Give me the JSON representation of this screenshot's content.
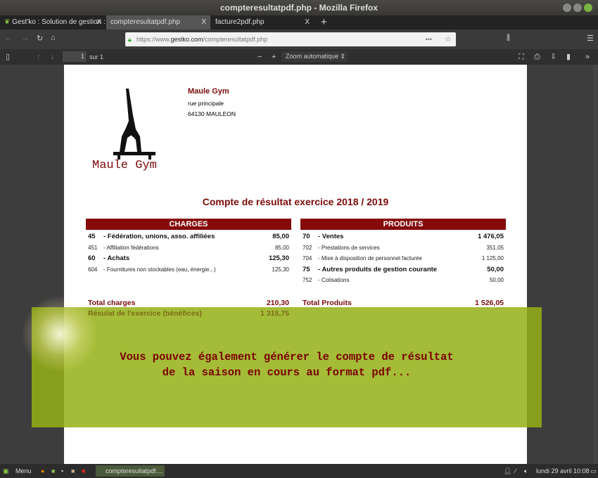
{
  "window": {
    "title": "compteresultatpdf.php - Mozilla Firefox"
  },
  "tabs": [
    {
      "label": "Gest'ko : Solution de gestion :",
      "close": "X"
    },
    {
      "label": "compteresultatpdf.php",
      "close": "X"
    },
    {
      "label": "facture2pdf.php",
      "close": "X"
    }
  ],
  "new_tab": "+",
  "url": {
    "prefix": "https://www.",
    "domain": "gestko.com",
    "path": "/compteresultatpdf.php",
    "more": "•••"
  },
  "pdf": {
    "page": "1",
    "of": "sur 1",
    "zoom": "Zoom automatique",
    "minus": "−",
    "plus": "+"
  },
  "company": {
    "name": "Maule Gym",
    "street": "rue principale",
    "city": "64130 MAULEON",
    "logo_text": "Maule Gym"
  },
  "report_title": "Compte de résultat exercice 2018 / 2019",
  "charges": {
    "header": "CHARGES",
    "rows": [
      {
        "code": "45",
        "label": "- Fédération, unions, asso. affiliées",
        "value": "85,00",
        "bold": true
      },
      {
        "code": "451",
        "label": "- Affiliation fédérations",
        "value": "85,00",
        "bold": false
      },
      {
        "code": "60",
        "label": "- Achats",
        "value": "125,30",
        "bold": true
      },
      {
        "code": "604",
        "label": "- Fournitures non stockables (eau, énergie...)",
        "value": "125,30",
        "bold": false
      }
    ],
    "total_label": "Total charges",
    "total_value": "210,30",
    "result_label": "Résulat de l'exercice (bénéfices)",
    "result_value": "1 315,75"
  },
  "produits": {
    "header": "PRODUITS",
    "rows": [
      {
        "code": "70",
        "label": "- Ventes",
        "value": "1 476,05",
        "bold": true
      },
      {
        "code": "702",
        "label": "- Prestations de services",
        "value": "351,05",
        "bold": false
      },
      {
        "code": "704",
        "label": "- Mise à disposition de personnel facturée",
        "value": "1 125,00",
        "bold": false
      },
      {
        "code": "75",
        "label": "- Autres produits de gestion courante",
        "value": "50,00",
        "bold": true
      },
      {
        "code": "752",
        "label": "- Cotisations",
        "value": "50,00",
        "bold": false
      }
    ],
    "total_label": "Total Produits",
    "total_value": "1 526,05"
  },
  "overlay": {
    "line1": "Vous pouvez également générer le compte de résultat",
    "line2": "de la saison en cours au format pdf...",
    "color": "#94b014"
  },
  "taskbar": {
    "menu": "Menu",
    "window": "compteresultatpdf....",
    "clock": "lundi 29 avril  10:08"
  },
  "colors": {
    "accent": "#850b0b"
  }
}
